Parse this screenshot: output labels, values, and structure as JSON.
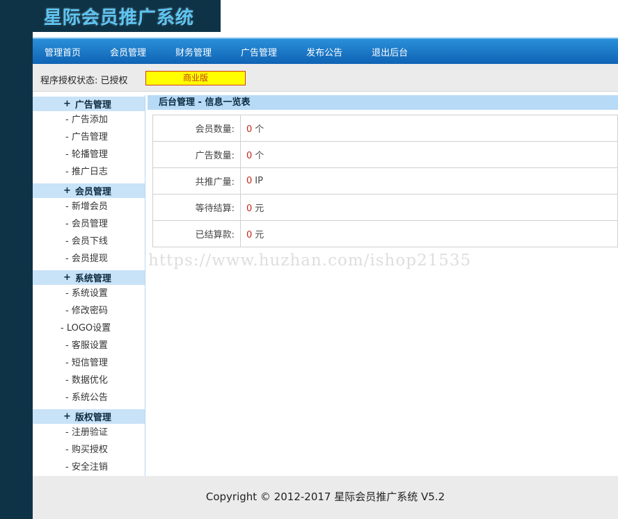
{
  "brand": {
    "title": "星际会员推广系统"
  },
  "nav": [
    "管理首页",
    "会员管理",
    "财务管理",
    "广告管理",
    "发布公告",
    "退出后台"
  ],
  "license": {
    "label": "程序授权状态: 已授权",
    "edition": "商业版"
  },
  "sidebar": [
    {
      "plus": "+",
      "title": "广告管理",
      "items": [
        "- 广告添加",
        "- 广告管理",
        "- 轮播管理",
        "- 推广日志"
      ]
    },
    {
      "plus": "+",
      "title": "会员管理",
      "items": [
        "- 新增会员",
        "- 会员管理",
        "- 会员下线",
        "- 会员提现"
      ]
    },
    {
      "plus": "+",
      "title": "系统管理",
      "items": [
        "- 系统设置",
        "- 修改密码",
        "- LOGO设置",
        "- 客服设置",
        "- 短信管理",
        "- 数据优化",
        "- 系统公告"
      ]
    },
    {
      "plus": "+",
      "title": "版权管理",
      "items": [
        "- 注册验证",
        "- 购买授权",
        "- 安全注销"
      ]
    }
  ],
  "main": {
    "header": "后台管理 - 信息一览表",
    "rows": [
      {
        "label": "会员数量:",
        "value": "0",
        "unit": "个"
      },
      {
        "label": "广告数量:",
        "value": "0",
        "unit": "个"
      },
      {
        "label": "共推广量:",
        "value": "0",
        "unit": "IP"
      },
      {
        "label": "等待结算:",
        "value": "0",
        "unit": "元"
      },
      {
        "label": "已结算款:",
        "value": "0",
        "unit": "元"
      }
    ]
  },
  "watermark": "https://www.huzhan.com/ishop21535",
  "footer": "Copyright © 2012-2017 星际会员推广系统 V5.2",
  "colors": {
    "dark": "#0e3347",
    "nav_blue": "#1573c4",
    "sidebar_header": "#c8e2f7",
    "badge_yellow": "#ffff00",
    "value_red": "#c0271a"
  }
}
